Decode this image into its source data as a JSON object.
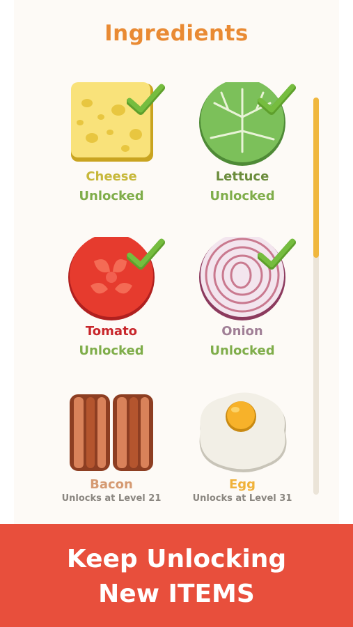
{
  "header": {
    "title": "Ingredients"
  },
  "ingredients": [
    {
      "name": "Cheese",
      "status": "Unlocked",
      "name_color": "#c7b83b",
      "icon": "cheese-icon",
      "unlocked": true
    },
    {
      "name": "Lettuce",
      "status": "Unlocked",
      "name_color": "#6b8c3c",
      "icon": "lettuce-icon",
      "unlocked": true
    },
    {
      "name": "Tomato",
      "status": "Unlocked",
      "name_color": "#c8262b",
      "icon": "tomato-icon",
      "unlocked": true
    },
    {
      "name": "Onion",
      "status": "Unlocked",
      "name_color": "#a07f96",
      "icon": "onion-icon",
      "unlocked": true
    },
    {
      "name": "Bacon",
      "status": "Unlocks at Level 21",
      "name_color": "#d59a72",
      "icon": "bacon-icon",
      "unlocked": false
    },
    {
      "name": "Egg",
      "status": "Unlocks at Level 31",
      "name_color": "#f0b23a",
      "icon": "egg-icon",
      "unlocked": false
    }
  ],
  "scroll": {
    "position_fraction": 0.0,
    "visible_fraction": 0.4
  },
  "banner": {
    "line1": "Keep Unlocking",
    "line2": "New ITEMS"
  },
  "colors": {
    "title": "#e98a33",
    "unlocked": "#7fad4a",
    "check": "#6fb33a",
    "banner": "#e84f3c",
    "scroll_thumb": "#f0b73e"
  }
}
